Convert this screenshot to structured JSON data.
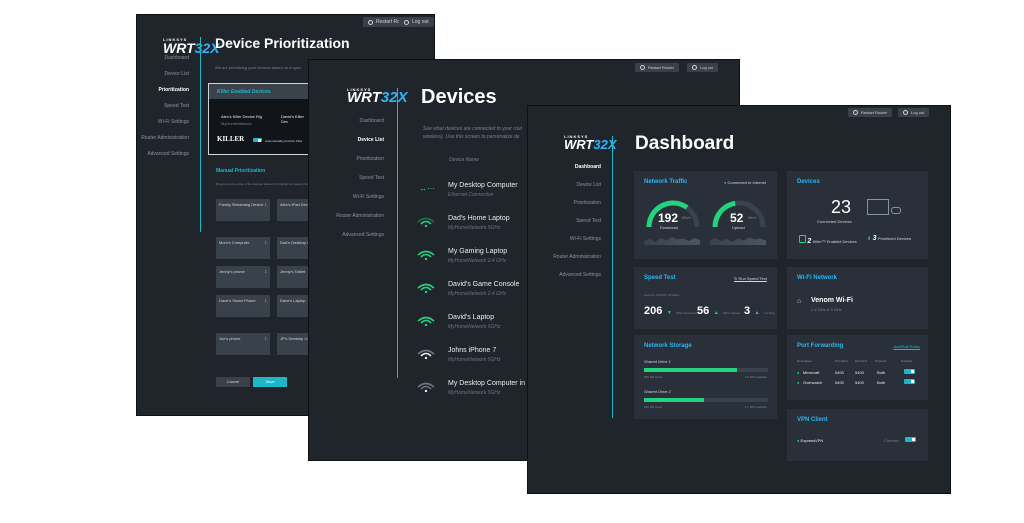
{
  "common": {
    "restart_label": "Restart Router",
    "logout_label": "Log out",
    "brand": "LINKSYS",
    "model_prefix": "WRT",
    "model_suffix": "32X"
  },
  "prioritization": {
    "title": "Device Prioritization",
    "intro": "We are prioritizing your devices based on a spec",
    "nav": [
      "Dashboard",
      "Device List",
      "Prioritization",
      "Speed Test",
      "Wi-Fi Settings",
      "Router Administration",
      "Advanced Settings"
    ],
    "killer_header": "Killer Enabled Devices",
    "killer_devices": [
      "Alex's Killer Device Rig",
      "David's Killer Dev"
    ],
    "killer_sub": "MyHomeNetwork",
    "killer_logo": "KILLER",
    "auto_label": "Automatically prioritize Killer",
    "manual_title": "Manual Prioritization",
    "manual_desc": "Drag to set the order of the devices below from highest to lowest priority",
    "devices": [
      {
        "name": "Family Streaming Device"
      },
      {
        "name": "Alex's iPad Devi"
      },
      {
        "name": "Mom's Computer"
      },
      {
        "name": "Dad's Desktop Computer"
      },
      {
        "name": "Jenny's phone"
      },
      {
        "name": "Jenny's Tablet"
      },
      {
        "name": "Dave's Smart Phone"
      },
      {
        "name": "Dave's Laptop"
      },
      {
        "name": "Joe's phone"
      },
      {
        "name": "JP's Desktop Computer"
      }
    ],
    "cancel_label": "Cancel",
    "save_label": "Save"
  },
  "devices_page": {
    "title": "Devices",
    "intro1": "See what devices are connected to your rout",
    "intro2": "wireless). Use this screen to personalize de",
    "column_header": "Device Name",
    "nav": [
      "Dashboard",
      "Device List",
      "Prioritization",
      "Speed Test",
      "Wi-Fi Settings",
      "Router Administration",
      "Advanced Settings"
    ],
    "devices": [
      {
        "name": "My Desktop Computer",
        "sub": "Ethernet Connection"
      },
      {
        "name": "Dad's Home Laptop",
        "sub": "MyHomeNetwork 5GHz"
      },
      {
        "name": "My Gaming Laptop",
        "sub": "MyHomeNetwork 2.4 GHz"
      },
      {
        "name": "David's Game Console",
        "sub": "MyHomeNetwork 2.4 GHz"
      },
      {
        "name": "David's Laptop",
        "sub": "MyHomeNetwork 5GHz"
      },
      {
        "name": "Johns iPhone 7",
        "sub": "MyHomeNetwork 5GHz"
      },
      {
        "name": "My Desktop Computer in li",
        "sub": "MyHomeNetwork 5GHz"
      }
    ]
  },
  "dashboard": {
    "title": "Dashboard",
    "nav": [
      "Dashboard",
      "Device List",
      "Prioritization",
      "Speed Test",
      "Wi-Fi Settings",
      "Router Administration",
      "Advanced Settings"
    ],
    "network_traffic": {
      "title": "Network Traffic",
      "status": "Connected to Internet",
      "download": "192",
      "upload": "52",
      "unit": "Mb/s",
      "download_label": "Download",
      "upload_label": "Upload",
      "download_level": 0.7,
      "upload_level": 0.45
    },
    "devices": {
      "title": "Devices",
      "count": "23",
      "count_label": "Connected Devices",
      "killer_count": "2",
      "killer_label": "Killer™ Enabled Devices",
      "prio_count": "3",
      "prio_label": "Prioritized Devices"
    },
    "speed_test": {
      "title": "Speed Test",
      "run_label": "Run Speed Test",
      "last": "Last run 10/21/17 11:08am",
      "download": "206",
      "upload": "56",
      "ping": "3",
      "download_label": "Download",
      "upload_label": "Upload",
      "ping_label": "Ping",
      "unit": "Mb/s",
      "ping_unit": "ms"
    },
    "wifi": {
      "title": "Wi-Fi Network",
      "name": "Venom Wi-Fi",
      "sub": "2.4 GHz & 5 GHz"
    },
    "storage": {
      "title": "Network Storage",
      "drives": [
        {
          "name": "Shared Drive 1",
          "used": "580 GB Used",
          "avail": "2.5 GB Available",
          "level": 0.75
        },
        {
          "name": "Shared Drive 2",
          "used": "580 GB Used",
          "avail": "1.7 GB Available",
          "level": 0.48
        }
      ]
    },
    "port_forwarding": {
      "title": "Port Forwarding",
      "add_label": "Add/Edit Rules",
      "headers": [
        "Description",
        "Port Start",
        "Port End",
        "Protocol",
        "Enabled"
      ],
      "rows": [
        {
          "desc": "Minecraft",
          "start": "5400",
          "end": "5400",
          "proto": "Both"
        },
        {
          "desc": "Overwatch",
          "start": "5400",
          "end": "5400",
          "proto": "Both"
        }
      ]
    },
    "vpn": {
      "title": "VPN Client",
      "name": "ExpressVPN",
      "status": "Connect"
    }
  }
}
